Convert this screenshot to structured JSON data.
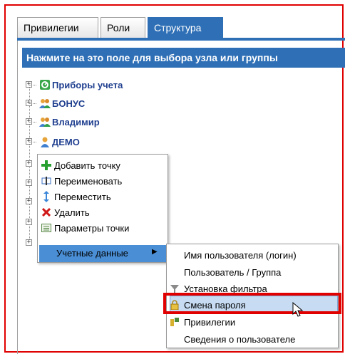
{
  "tabs": [
    {
      "label": "Привилегии",
      "active": false
    },
    {
      "label": "Роли",
      "active": false
    },
    {
      "label": "Структура",
      "active": true
    }
  ],
  "selector_bar": "Нажмите на это поле для выбора узла или группы",
  "tree": {
    "nodes": [
      {
        "label": "Приборы учета",
        "icon": "meter-icon"
      },
      {
        "label": "БОНУС",
        "icon": "group-users-icon"
      },
      {
        "label": "Владимир",
        "icon": "group-users-icon"
      },
      {
        "label": "ДЕМО",
        "icon": "user-icon"
      }
    ]
  },
  "context_menu": {
    "items": [
      {
        "label": "Добавить точку",
        "icon": "green-plus-icon"
      },
      {
        "label": "Переименовать",
        "icon": "rename-icon"
      },
      {
        "label": "Переместить",
        "icon": "move-arrows-icon"
      },
      {
        "label": "Удалить",
        "icon": "red-x-icon"
      },
      {
        "label": "Параметры точки",
        "icon": "settings-list-icon"
      }
    ],
    "submenu_trigger": "Учетные данные"
  },
  "submenu": {
    "items": [
      {
        "label": "Имя пользователя (логин)"
      },
      {
        "label": "Пользователь / Группа"
      },
      {
        "label": "Установка фильтра",
        "icon": "filter-icon"
      },
      {
        "label": "Смена пароля",
        "icon": "lock-icon",
        "highlighted": true
      },
      {
        "label": "Привилегии",
        "icon": "privileges-icon"
      },
      {
        "label": "Сведения о пользователе"
      }
    ]
  },
  "colors": {
    "accent": "#2e6fb6",
    "highlight_frame": "#e00000",
    "submenu_hover": "#c7dcf3"
  }
}
